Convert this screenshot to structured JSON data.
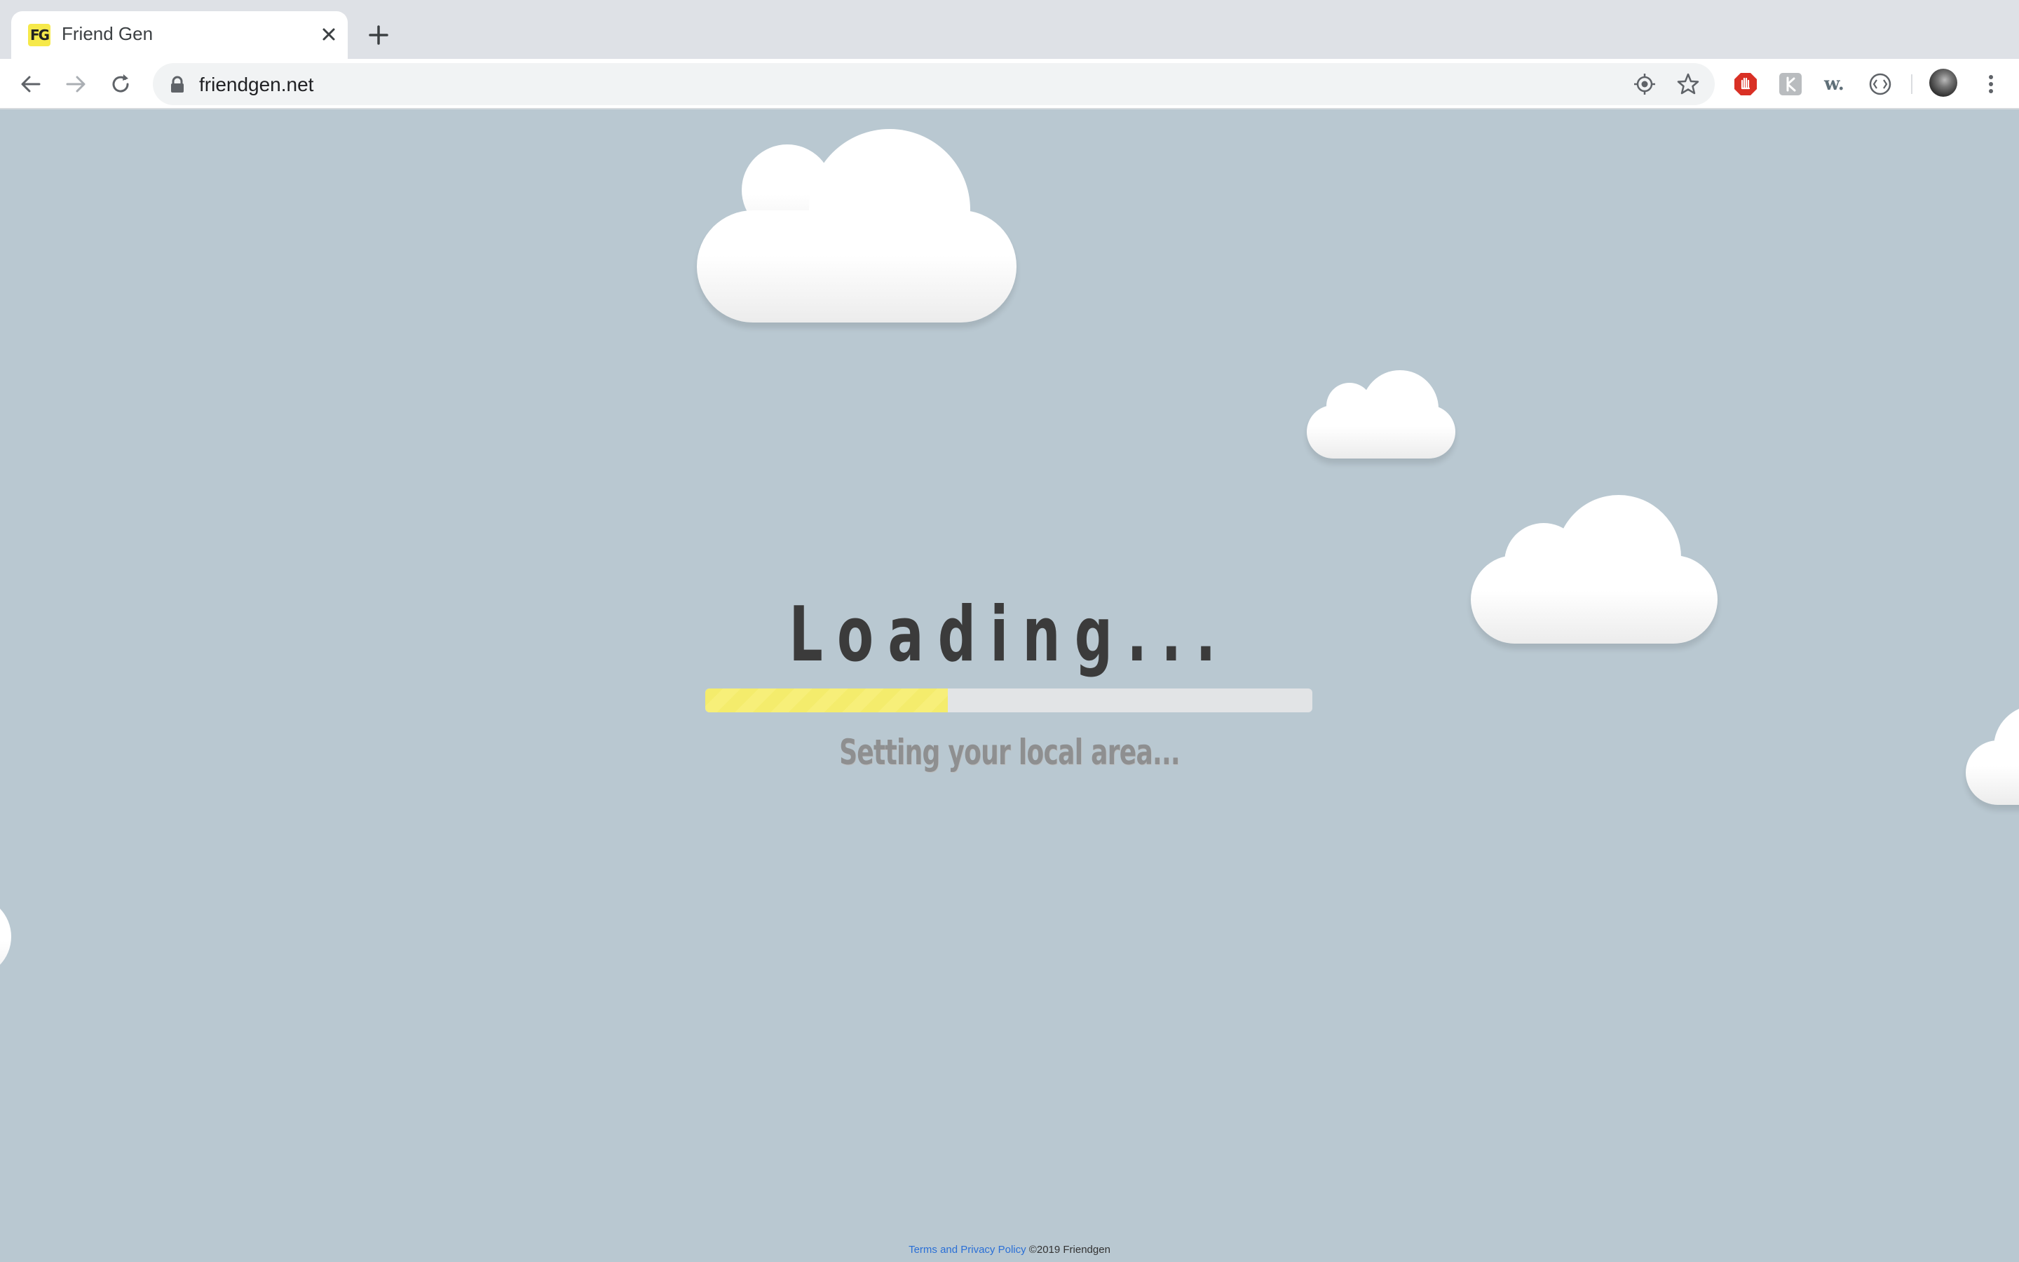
{
  "browser": {
    "tab_title": "Friend Gen",
    "favicon_text": "FG",
    "url": "friendgen.net",
    "icons": [
      "back-icon",
      "forward-icon",
      "reload-icon",
      "lock-icon",
      "location-icon",
      "star-icon",
      "adblock-extension-icon",
      "extension-icon",
      "wordtune-extension-icon",
      "code-extension-icon",
      "profile-avatar",
      "more-menu-icon"
    ]
  },
  "page": {
    "loading_title": "Loading...",
    "progress_percent": 40,
    "status_text": "Setting your local area...",
    "footer_link": "Terms and Privacy Policy",
    "footer_copyright": "©2019 Friendgen"
  },
  "colors": {
    "background": "#b9c8d1",
    "progress_fill": "#f4ec6c",
    "progress_track": "#e2e4e6",
    "title": "#3b3b3b",
    "status": "#8e8f90",
    "link": "#2a6fd6"
  }
}
